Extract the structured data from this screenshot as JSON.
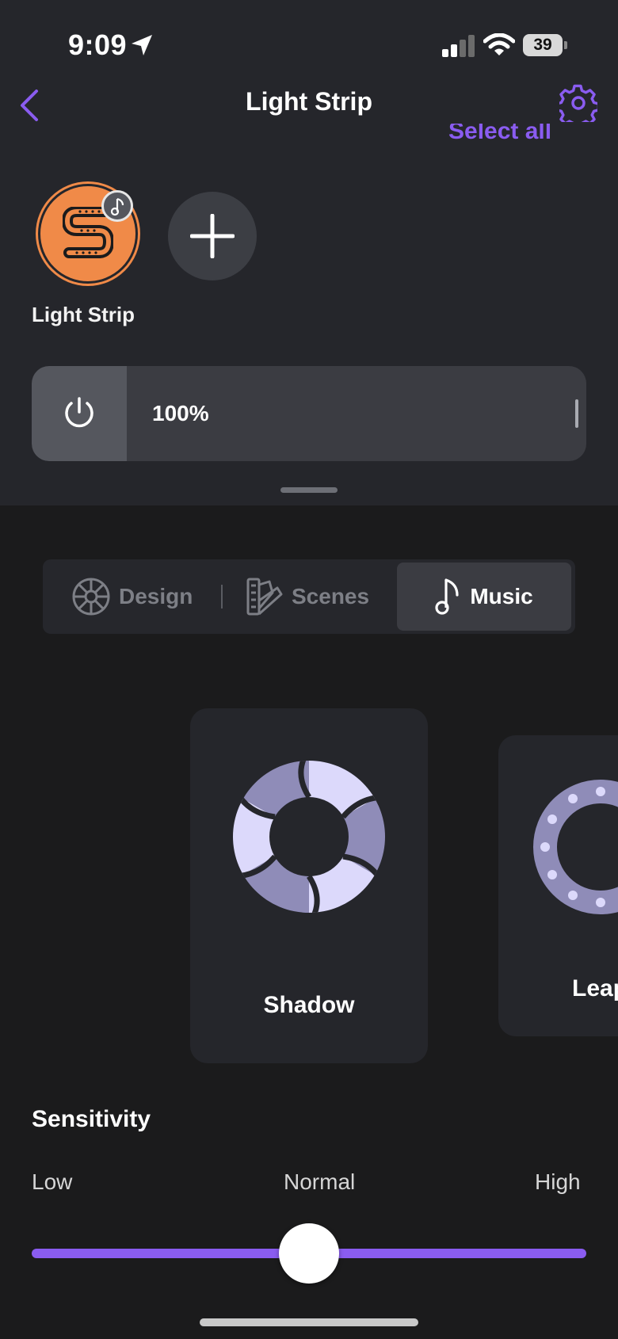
{
  "status_bar": {
    "time": "9:09",
    "battery": "39",
    "icons": [
      "location-arrow-icon",
      "cellular-signal-icon",
      "wifi-icon",
      "battery-icon"
    ]
  },
  "header": {
    "title": "Light Strip",
    "select_all": "Select all",
    "icons": [
      "chevron-left-icon",
      "gear-icon"
    ]
  },
  "devices": [
    {
      "label": "Light Strip",
      "icons": [
        "light-strip-icon",
        "music-note-icon"
      ]
    }
  ],
  "brightness": {
    "value": "100%",
    "level": 1.0
  },
  "tabs": [
    {
      "label": "Design",
      "icon": "color-wheel-icon",
      "active": false
    },
    {
      "label": "Scenes",
      "icon": "swatch-icon",
      "active": false
    },
    {
      "label": "Music",
      "icon": "music-note-icon",
      "active": true
    }
  ],
  "music_modes": [
    {
      "name": "Shadow",
      "icon": "aperture-icon"
    },
    {
      "name": "Leap",
      "icon": "ring-dots-icon"
    }
  ],
  "sensitivity": {
    "title": "Sensitivity",
    "low": "Low",
    "normal": "Normal",
    "high": "High",
    "level": 0.5
  },
  "colors": {
    "accent": "#8a5cf0",
    "device": "#f08a48",
    "panel": "#25262b",
    "background": "#1b1b1c"
  }
}
